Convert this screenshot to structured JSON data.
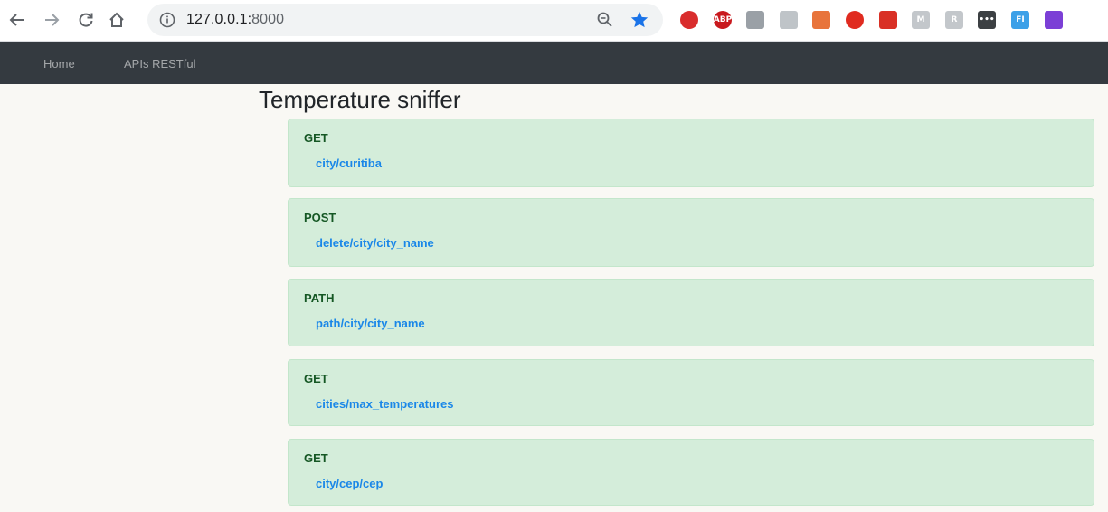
{
  "browser": {
    "url_host": "127.0.0.1:",
    "url_port": "8000",
    "extensions": [
      {
        "name": "adblock-icon",
        "color": "#d92d2d"
      },
      {
        "name": "adblock-plus-icon",
        "label": "ABP",
        "color": "#c9191e"
      },
      {
        "name": "extension-icon",
        "color": "#9aa0a6"
      },
      {
        "name": "extension-icon",
        "color": "#bfc4c8"
      },
      {
        "name": "image-extension-icon",
        "color": "#e8743b"
      },
      {
        "name": "youtube-icon",
        "color": "#e02b20"
      },
      {
        "name": "extension-icon",
        "color": "#d93025"
      },
      {
        "name": "extension-icon",
        "label": "M",
        "color": "#c3c7cb"
      },
      {
        "name": "extension-icon",
        "label": "R",
        "color": "#c3c7cb"
      },
      {
        "name": "extension-icon",
        "label": "•••",
        "color": "#3c4043"
      },
      {
        "name": "extension-icon",
        "label": "FI",
        "color": "#3ca0e8"
      },
      {
        "name": "extension-icon",
        "color": "#7b3fd6"
      }
    ]
  },
  "navbar": {
    "links": [
      "Home",
      "APIs RESTful"
    ],
    "background": "#343a40"
  },
  "page": {
    "title": "Temperature sniffer"
  },
  "endpoints": [
    {
      "method": "GET",
      "path": "city/curitiba"
    },
    {
      "method": "POST",
      "path": "delete/city/city_name"
    },
    {
      "method": "PATH",
      "path": "path/city/city_name"
    },
    {
      "method": "GET",
      "path": "cities/max_temperatures"
    },
    {
      "method": "GET",
      "path": "city/cep/cep"
    }
  ],
  "colors": {
    "card_bg": "#d4edda",
    "card_border": "#c3e6cb",
    "method_text": "#155724",
    "link": "#1a87e8"
  }
}
